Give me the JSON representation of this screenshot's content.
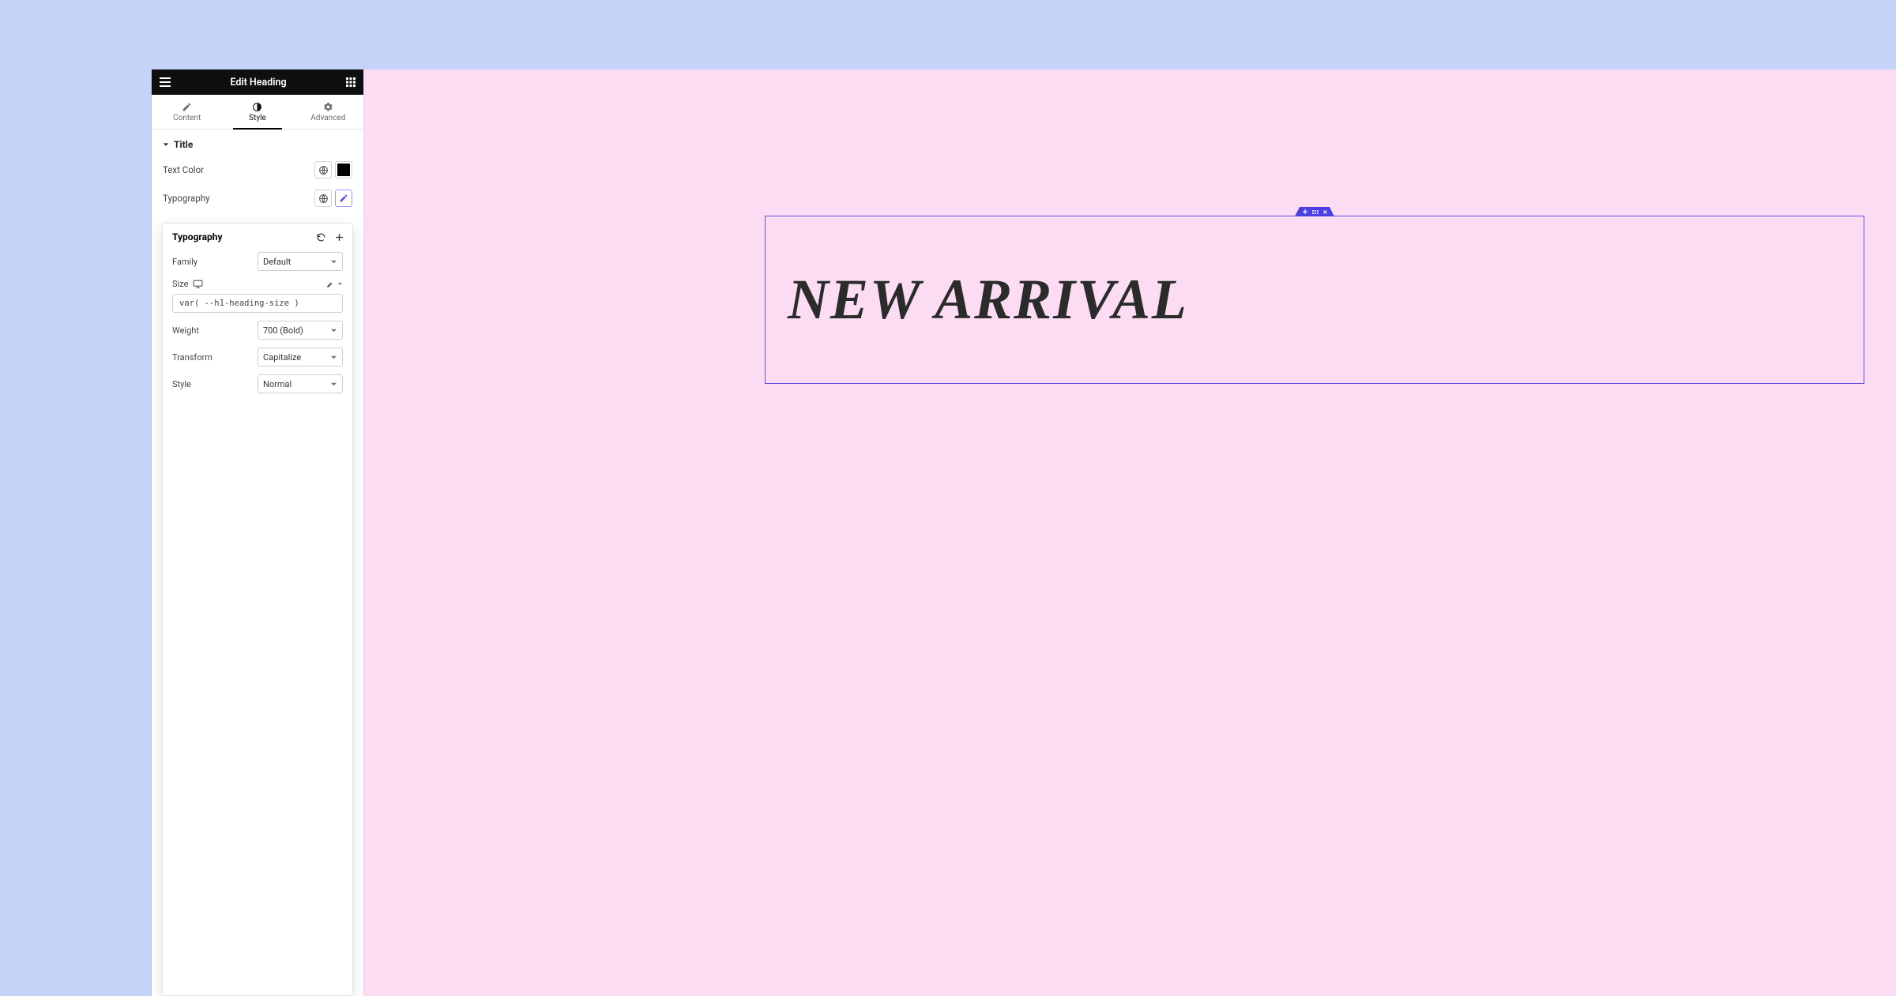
{
  "header": {
    "title": "Edit Heading"
  },
  "tabs": {
    "content": "Content",
    "style": "Style",
    "advanced": "Advanced"
  },
  "section": {
    "title": "Title",
    "text_color_label": "Text Color",
    "typography_label": "Typography"
  },
  "colors": {
    "text_color": "#000000"
  },
  "popover": {
    "title": "Typography",
    "family_label": "Family",
    "family_value": "Default",
    "size_label": "Size",
    "size_value": "var( --h1-heading-size )",
    "weight_label": "Weight",
    "weight_value": "700 (Bold)",
    "transform_label": "Transform",
    "transform_value": "Capitalize",
    "style_label": "Style",
    "style_value": "Normal"
  },
  "canvas": {
    "heading_text": "NEW ARRIVAL"
  }
}
